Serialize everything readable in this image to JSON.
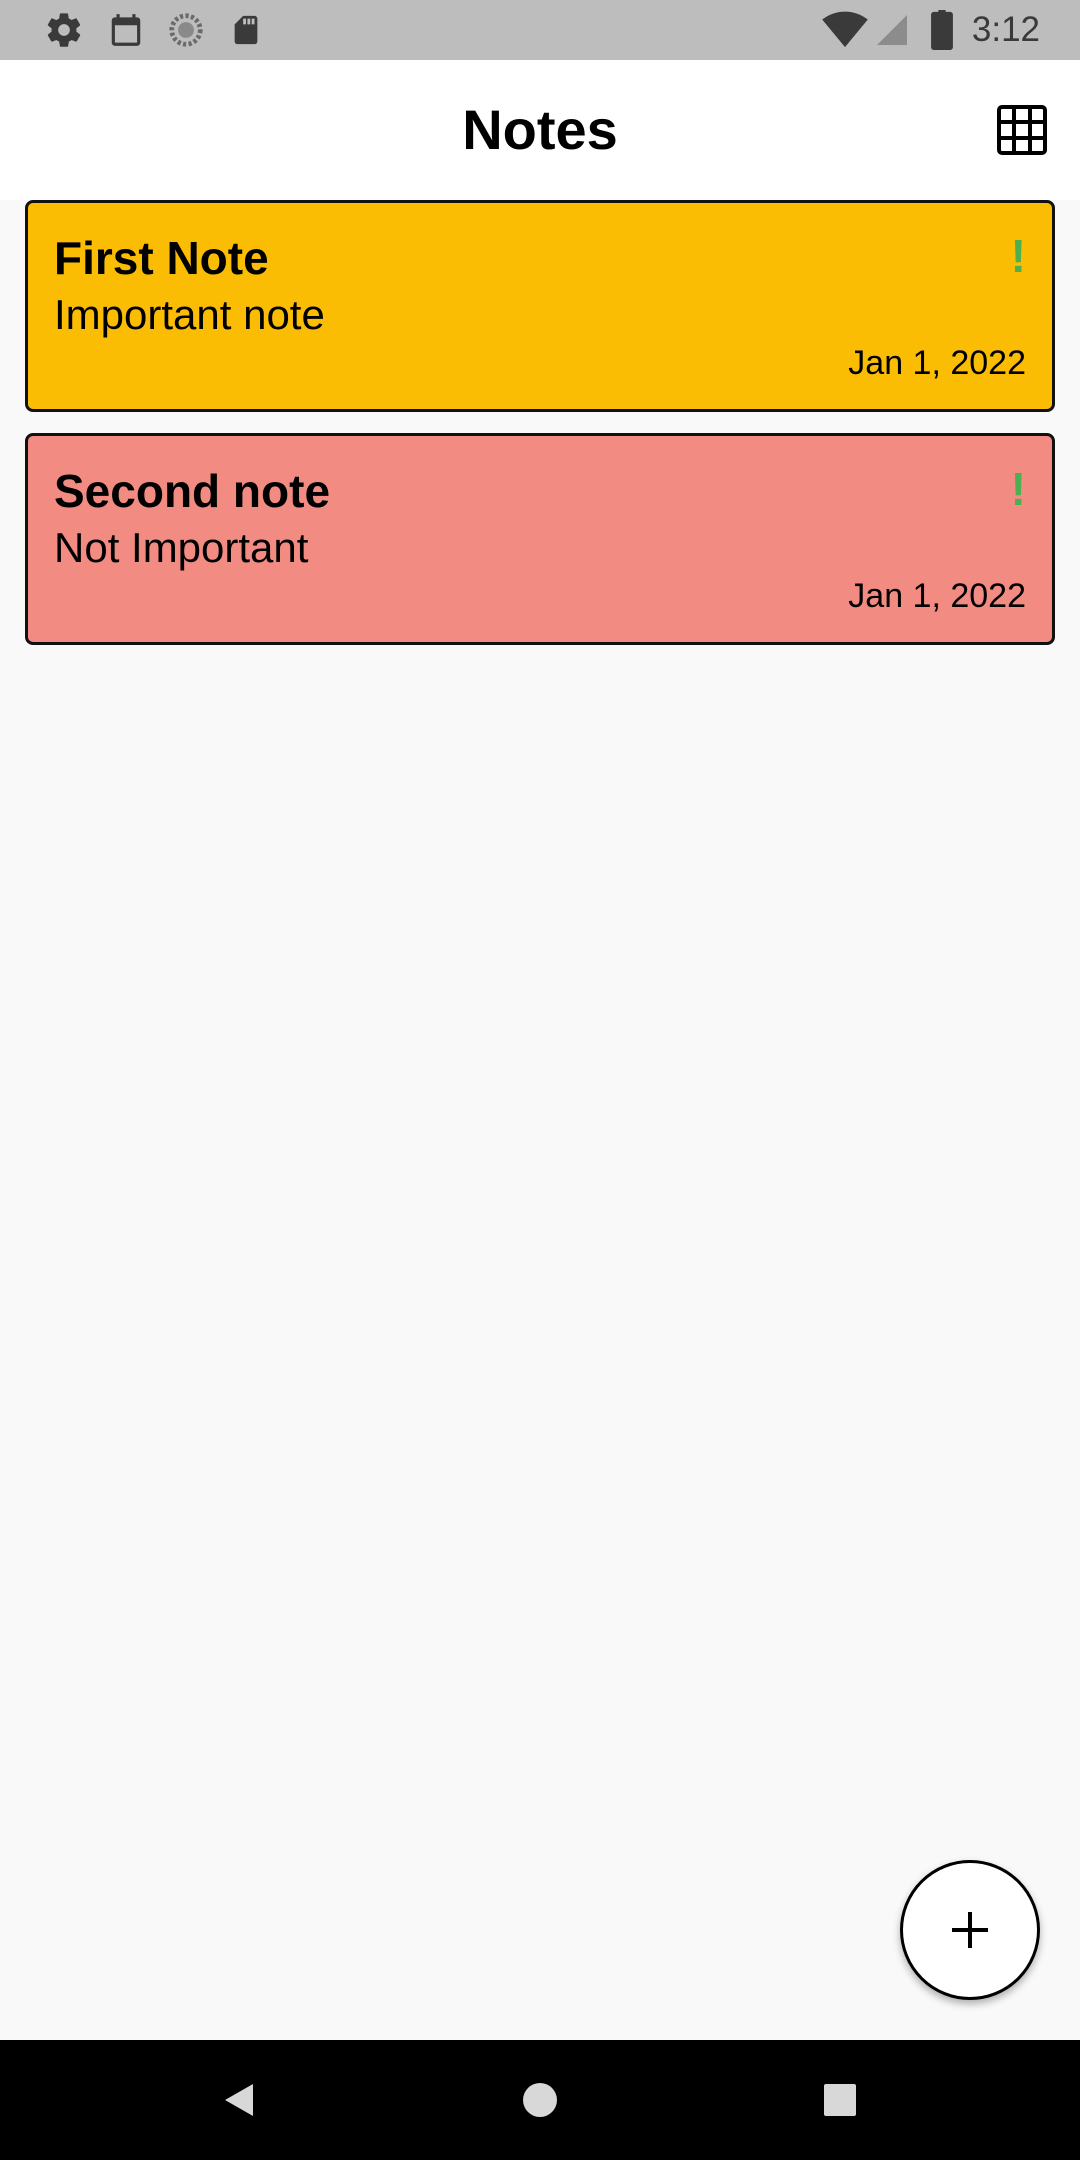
{
  "status_bar": {
    "time": "3:12",
    "left_icons": [
      "gear-icon",
      "calendar-icon",
      "sync-icon",
      "sd-card-icon"
    ],
    "right_icons": [
      "wifi-icon",
      "signal-icon",
      "battery-icon"
    ]
  },
  "app_bar": {
    "title": "Notes",
    "layout_toggle_icon": "grid-icon"
  },
  "notes": [
    {
      "title": "First Note",
      "body": "Important note",
      "date": "Jan 1, 2022",
      "flag": "!",
      "color": "#fbbc04"
    },
    {
      "title": "Second note",
      "body": "Not Important",
      "date": "Jan 1, 2022",
      "flag": "!",
      "color": "#f28b82"
    }
  ],
  "fab": {
    "icon": "plus-icon"
  },
  "nav_bar": {
    "icons": [
      "back-icon",
      "home-icon",
      "recents-icon"
    ]
  },
  "colors": {
    "status_bar": "#bdbdbd",
    "app_bar": "#ffffff",
    "background": "#f9f9f9",
    "flag": "#4caf50",
    "nav_bar": "#000000"
  }
}
